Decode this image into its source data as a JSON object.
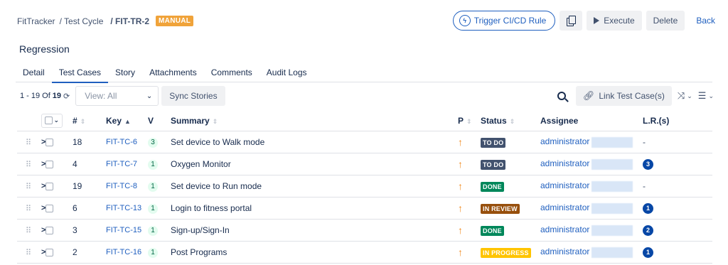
{
  "breadcrumb": {
    "project": "FitTracker",
    "cycle": "/ Test Cycle",
    "current": "/ FIT-TR-2",
    "badge": "MANUAL"
  },
  "actions": {
    "trigger": "Trigger CI/CD Rule",
    "execute": "Execute",
    "delete": "Delete",
    "back": "Back"
  },
  "page_title": "Regression",
  "tabs": [
    {
      "label": "Detail"
    },
    {
      "label": "Test Cases"
    },
    {
      "label": "Story"
    },
    {
      "label": "Attachments"
    },
    {
      "label": "Comments"
    },
    {
      "label": "Audit Logs"
    }
  ],
  "toolbar": {
    "range": "1 - 19",
    "of": "Of",
    "total": "19",
    "view_label": "View: All",
    "sync": "Sync Stories",
    "link_test_cases": "Link Test Case(s)"
  },
  "table": {
    "headers": {
      "num": "#",
      "key": "Key",
      "v": "V",
      "summary": "Summary",
      "p": "P",
      "status": "Status",
      "assignee": "Assignee",
      "lr": "L.R.(s)"
    },
    "rows": [
      {
        "num": "18",
        "key": "FIT-TC-6",
        "v": "3",
        "summary": "Set device to Walk mode",
        "p": "↑",
        "status": "TO DO",
        "status_color": "#42526e",
        "assignee": "administrator",
        "lr": "-"
      },
      {
        "num": "4",
        "key": "FIT-TC-7",
        "v": "1",
        "summary": "Oxygen Monitor",
        "p": "↑",
        "status": "TO DO",
        "status_color": "#42526e",
        "assignee": "administrator",
        "lr": "3"
      },
      {
        "num": "19",
        "key": "FIT-TC-8",
        "v": "1",
        "summary": "Set device to Run mode",
        "p": "↑",
        "status": "DONE",
        "status_color": "#00875a",
        "assignee": "administrator",
        "lr": "-"
      },
      {
        "num": "6",
        "key": "FIT-TC-13",
        "v": "1",
        "summary": "Login to fitness portal",
        "p": "↑",
        "status": "IN REVIEW",
        "status_color": "#974f0c",
        "assignee": "administrator",
        "lr": "1"
      },
      {
        "num": "3",
        "key": "FIT-TC-15",
        "v": "1",
        "summary": "Sign-up/Sign-In",
        "p": "↑",
        "status": "DONE",
        "status_color": "#00875a",
        "assignee": "administrator",
        "lr": "2"
      },
      {
        "num": "2",
        "key": "FIT-TC-16",
        "v": "1",
        "summary": "Post Programs",
        "p": "↑",
        "status": "IN PROGRESS",
        "status_color": "#ffc400",
        "assignee": "administrator",
        "lr": "1"
      }
    ]
  }
}
